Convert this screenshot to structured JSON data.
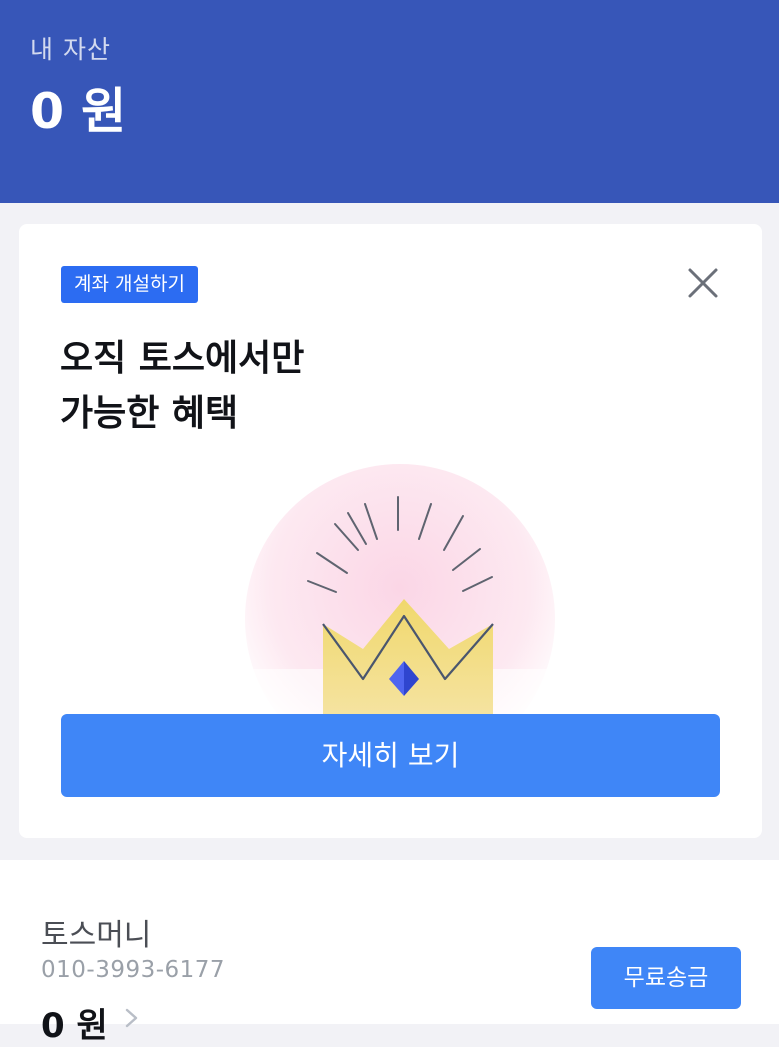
{
  "header": {
    "label": "내 자산",
    "amount": "0 원",
    "background": "#3756b8"
  },
  "promo": {
    "badge": "계좌 개설하기",
    "headline_line1": "오직 토스에서만",
    "headline_line2": "가능한 혜택",
    "cta_label": "자세히 보기",
    "close_icon": "close-icon",
    "illustration_icon": "crown-icon",
    "accent": "#3f86f7",
    "badge_color": "#2c6cf2"
  },
  "toss_money": {
    "title": "토스머니",
    "account": "010-3993-6177",
    "amount": "0 원",
    "transfer_label": "무료송금",
    "chevron_icon": "chevron-right-icon"
  }
}
